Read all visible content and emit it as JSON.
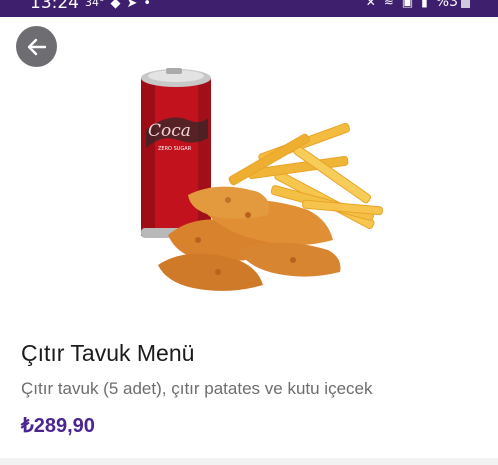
{
  "status_bar": {
    "time": "13:24",
    "temperature": "34°",
    "battery_percent": "%3",
    "color": "#3e1f6e"
  },
  "back_button": {
    "icon": "arrow-left-icon"
  },
  "product": {
    "image_icon": "cola-chicken-fries-photo",
    "title": "Çıtır Tavuk Menü",
    "description": "Çıtır tavuk (5 adet), çıtır patates ve kutu içecek",
    "price": "₺289,90",
    "price_color": "#4b2590"
  }
}
